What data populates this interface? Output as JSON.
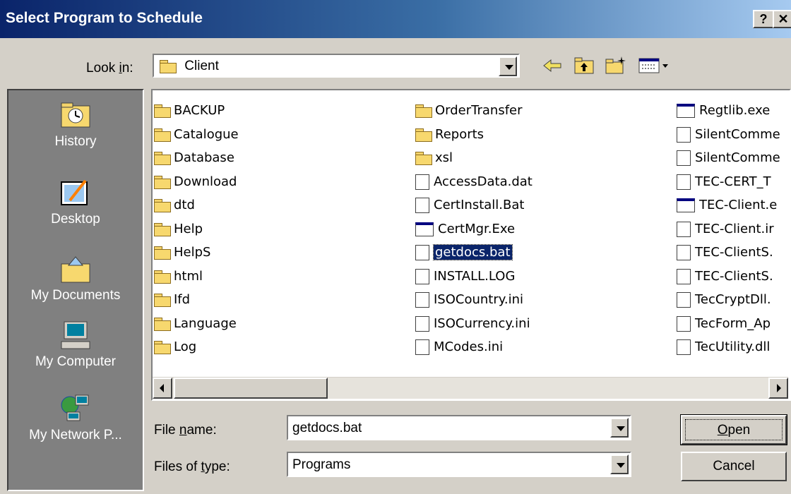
{
  "window": {
    "title": "Select Program to Schedule",
    "help_glyph": "?",
    "close_glyph": "✕"
  },
  "lookin": {
    "label": "Look in:",
    "value": "Client"
  },
  "places": [
    {
      "label": "History"
    },
    {
      "label": "Desktop"
    },
    {
      "label": "My Documents"
    },
    {
      "label": "My Computer"
    },
    {
      "label": "My Network P..."
    }
  ],
  "files": {
    "col1": [
      "BACKUP",
      "Catalogue",
      "Database",
      "Download",
      "dtd",
      "Help",
      "HelpS",
      "html",
      "Ifd",
      "Language",
      "Log"
    ],
    "col2": [
      "OrderTransfer",
      "Reports",
      "xsl",
      "AccessData.dat",
      "CertInstall.Bat",
      "CertMgr.Exe",
      "getdocs.bat",
      "INSTALL.LOG",
      "ISOCountry.ini",
      "ISOCurrency.ini",
      "MCodes.ini"
    ],
    "col3": [
      "Regtlib.exe",
      "SilentComme",
      "SilentComme",
      "TEC-CERT_T",
      "TEC-Client.e",
      "TEC-Client.ir",
      "TEC-ClientS.",
      "TEC-ClientS.",
      "TecCryptDll.",
      "TecForm_Ap",
      "TecUtility.dll"
    ],
    "selected": "getdocs.bat"
  },
  "filename": {
    "label": "File name:",
    "value": "getdocs.bat"
  },
  "filetype": {
    "label": "Files of type:",
    "value": "Programs"
  },
  "buttons": {
    "open": "Open",
    "cancel": "Cancel"
  }
}
